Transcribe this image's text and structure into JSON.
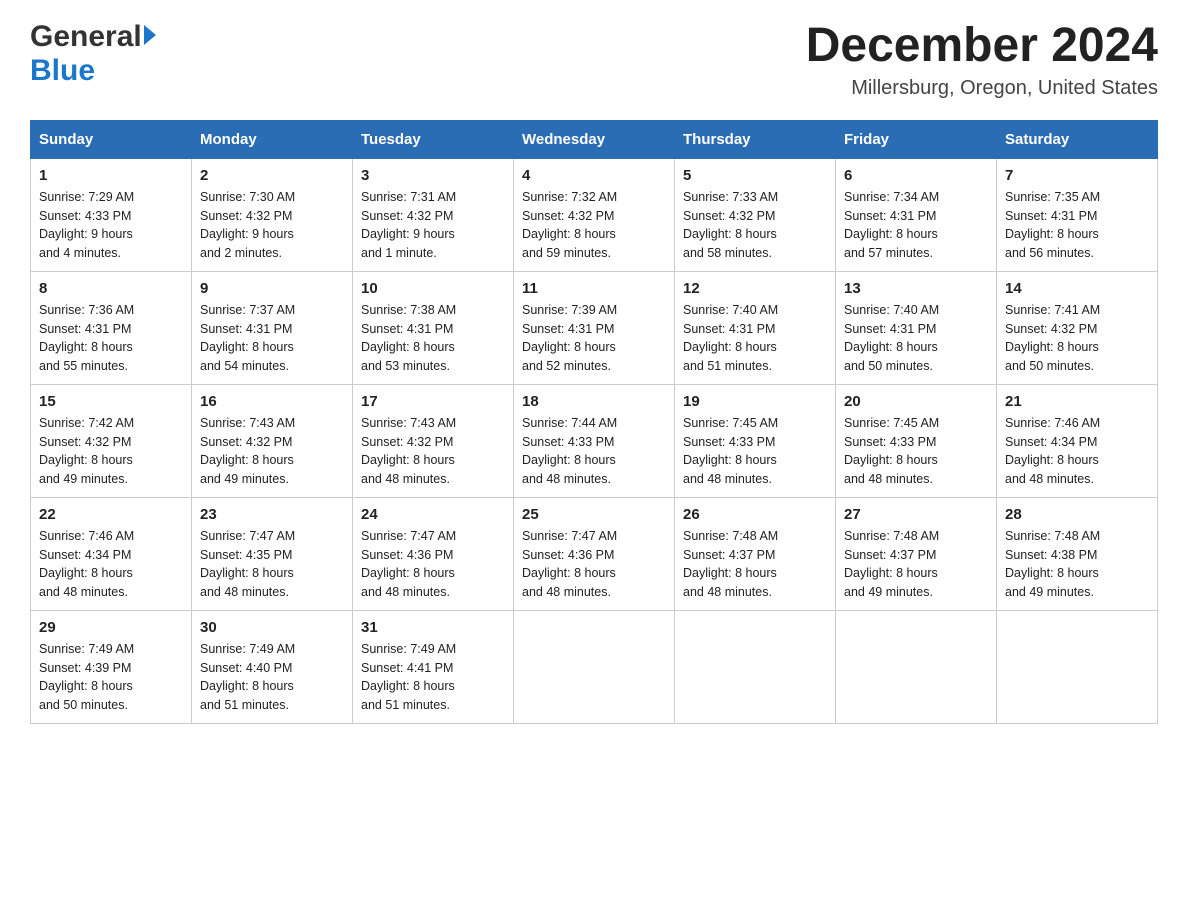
{
  "header": {
    "logo_general": "General",
    "logo_blue": "Blue",
    "month_title": "December 2024",
    "location": "Millersburg, Oregon, United States"
  },
  "days_of_week": [
    "Sunday",
    "Monday",
    "Tuesday",
    "Wednesday",
    "Thursday",
    "Friday",
    "Saturday"
  ],
  "weeks": [
    [
      {
        "day": "1",
        "sunrise": "7:29 AM",
        "sunset": "4:33 PM",
        "daylight": "9 hours and 4 minutes."
      },
      {
        "day": "2",
        "sunrise": "7:30 AM",
        "sunset": "4:32 PM",
        "daylight": "9 hours and 2 minutes."
      },
      {
        "day": "3",
        "sunrise": "7:31 AM",
        "sunset": "4:32 PM",
        "daylight": "9 hours and 1 minute."
      },
      {
        "day": "4",
        "sunrise": "7:32 AM",
        "sunset": "4:32 PM",
        "daylight": "8 hours and 59 minutes."
      },
      {
        "day": "5",
        "sunrise": "7:33 AM",
        "sunset": "4:32 PM",
        "daylight": "8 hours and 58 minutes."
      },
      {
        "day": "6",
        "sunrise": "7:34 AM",
        "sunset": "4:31 PM",
        "daylight": "8 hours and 57 minutes."
      },
      {
        "day": "7",
        "sunrise": "7:35 AM",
        "sunset": "4:31 PM",
        "daylight": "8 hours and 56 minutes."
      }
    ],
    [
      {
        "day": "8",
        "sunrise": "7:36 AM",
        "sunset": "4:31 PM",
        "daylight": "8 hours and 55 minutes."
      },
      {
        "day": "9",
        "sunrise": "7:37 AM",
        "sunset": "4:31 PM",
        "daylight": "8 hours and 54 minutes."
      },
      {
        "day": "10",
        "sunrise": "7:38 AM",
        "sunset": "4:31 PM",
        "daylight": "8 hours and 53 minutes."
      },
      {
        "day": "11",
        "sunrise": "7:39 AM",
        "sunset": "4:31 PM",
        "daylight": "8 hours and 52 minutes."
      },
      {
        "day": "12",
        "sunrise": "7:40 AM",
        "sunset": "4:31 PM",
        "daylight": "8 hours and 51 minutes."
      },
      {
        "day": "13",
        "sunrise": "7:40 AM",
        "sunset": "4:31 PM",
        "daylight": "8 hours and 50 minutes."
      },
      {
        "day": "14",
        "sunrise": "7:41 AM",
        "sunset": "4:32 PM",
        "daylight": "8 hours and 50 minutes."
      }
    ],
    [
      {
        "day": "15",
        "sunrise": "7:42 AM",
        "sunset": "4:32 PM",
        "daylight": "8 hours and 49 minutes."
      },
      {
        "day": "16",
        "sunrise": "7:43 AM",
        "sunset": "4:32 PM",
        "daylight": "8 hours and 49 minutes."
      },
      {
        "day": "17",
        "sunrise": "7:43 AM",
        "sunset": "4:32 PM",
        "daylight": "8 hours and 48 minutes."
      },
      {
        "day": "18",
        "sunrise": "7:44 AM",
        "sunset": "4:33 PM",
        "daylight": "8 hours and 48 minutes."
      },
      {
        "day": "19",
        "sunrise": "7:45 AM",
        "sunset": "4:33 PM",
        "daylight": "8 hours and 48 minutes."
      },
      {
        "day": "20",
        "sunrise": "7:45 AM",
        "sunset": "4:33 PM",
        "daylight": "8 hours and 48 minutes."
      },
      {
        "day": "21",
        "sunrise": "7:46 AM",
        "sunset": "4:34 PM",
        "daylight": "8 hours and 48 minutes."
      }
    ],
    [
      {
        "day": "22",
        "sunrise": "7:46 AM",
        "sunset": "4:34 PM",
        "daylight": "8 hours and 48 minutes."
      },
      {
        "day": "23",
        "sunrise": "7:47 AM",
        "sunset": "4:35 PM",
        "daylight": "8 hours and 48 minutes."
      },
      {
        "day": "24",
        "sunrise": "7:47 AM",
        "sunset": "4:36 PM",
        "daylight": "8 hours and 48 minutes."
      },
      {
        "day": "25",
        "sunrise": "7:47 AM",
        "sunset": "4:36 PM",
        "daylight": "8 hours and 48 minutes."
      },
      {
        "day": "26",
        "sunrise": "7:48 AM",
        "sunset": "4:37 PM",
        "daylight": "8 hours and 48 minutes."
      },
      {
        "day": "27",
        "sunrise": "7:48 AM",
        "sunset": "4:37 PM",
        "daylight": "8 hours and 49 minutes."
      },
      {
        "day": "28",
        "sunrise": "7:48 AM",
        "sunset": "4:38 PM",
        "daylight": "8 hours and 49 minutes."
      }
    ],
    [
      {
        "day": "29",
        "sunrise": "7:49 AM",
        "sunset": "4:39 PM",
        "daylight": "8 hours and 50 minutes."
      },
      {
        "day": "30",
        "sunrise": "7:49 AM",
        "sunset": "4:40 PM",
        "daylight": "8 hours and 51 minutes."
      },
      {
        "day": "31",
        "sunrise": "7:49 AM",
        "sunset": "4:41 PM",
        "daylight": "8 hours and 51 minutes."
      },
      null,
      null,
      null,
      null
    ]
  ],
  "labels": {
    "sunrise": "Sunrise:",
    "sunset": "Sunset:",
    "daylight": "Daylight:"
  }
}
